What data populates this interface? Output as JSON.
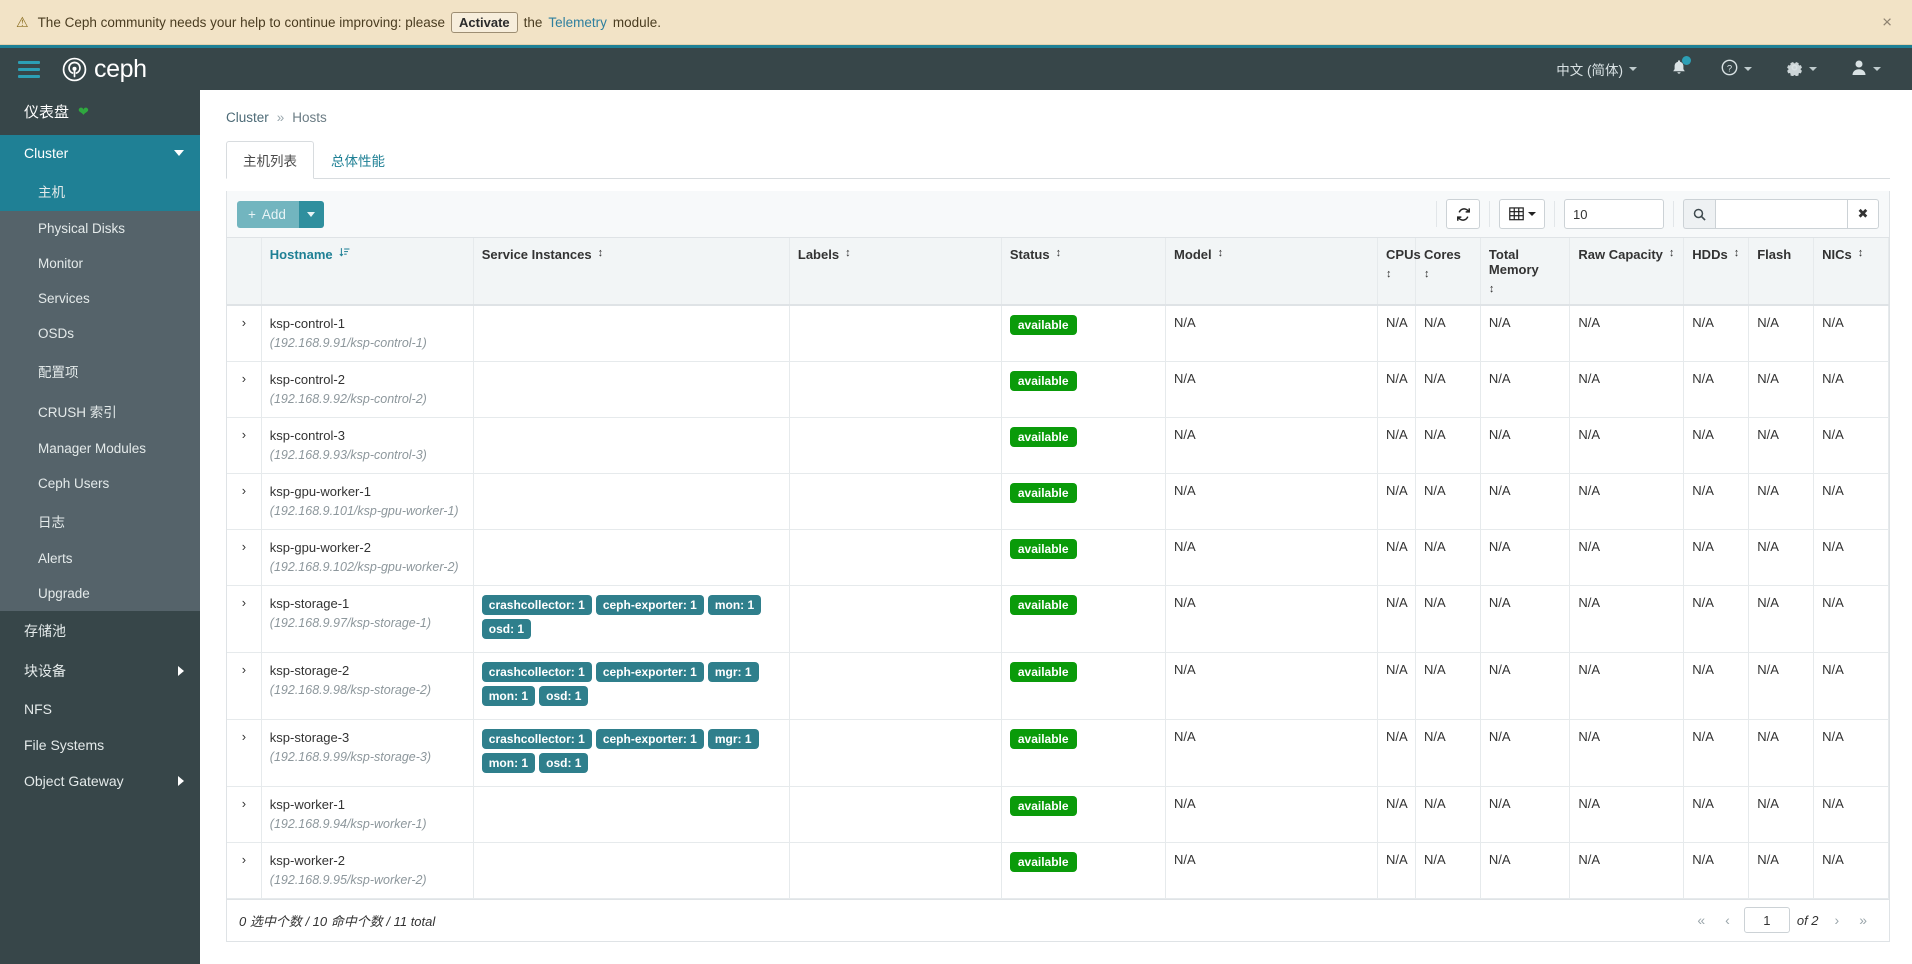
{
  "banner": {
    "icon": "warning-triangle-icon",
    "text_before": "The Ceph community needs your help to continue improving: please",
    "activate_label": "Activate",
    "text_mid": "the",
    "link_label": "Telemetry",
    "text_after": "module.",
    "close_label": "×",
    "bg_color": "#f2e3c6"
  },
  "navbar": {
    "brand": "ceph",
    "language": "中文 (简体)",
    "accent_color": "#1f8095",
    "bg_color": "#374649",
    "items": [
      {
        "name": "bell-icon",
        "label": ""
      },
      {
        "name": "help-icon",
        "label": ""
      },
      {
        "name": "gear-icon",
        "label": ""
      },
      {
        "name": "user-icon",
        "label": ""
      }
    ]
  },
  "sidebar": {
    "dashboard_label": "仪表盘",
    "cluster_label": "Cluster",
    "cluster_children": [
      {
        "label": "主机",
        "active": true
      },
      {
        "label": "Physical Disks",
        "active": false
      },
      {
        "label": "Monitor",
        "active": false
      },
      {
        "label": "Services",
        "active": false
      },
      {
        "label": "OSDs",
        "active": false
      },
      {
        "label": "配置项",
        "active": false
      },
      {
        "label": "CRUSH 索引",
        "active": false
      },
      {
        "label": "Manager Modules",
        "active": false
      },
      {
        "label": "Ceph Users",
        "active": false
      },
      {
        "label": "日志",
        "active": false
      },
      {
        "label": "Alerts",
        "active": false
      },
      {
        "label": "Upgrade",
        "active": false
      }
    ],
    "bottom_items": [
      {
        "label": "存储池",
        "expandable": false
      },
      {
        "label": "块设备",
        "expandable": true
      },
      {
        "label": "NFS",
        "expandable": false
      },
      {
        "label": "File Systems",
        "expandable": false
      },
      {
        "label": "Object Gateway",
        "expandable": true
      }
    ]
  },
  "breadcrumb": {
    "root": "Cluster",
    "separator": "»",
    "current": "Hosts"
  },
  "tabs": [
    {
      "label": "主机列表",
      "active": true
    },
    {
      "label": "总体性能",
      "active": false
    }
  ],
  "toolbar": {
    "add_label": "Add",
    "add_plus": "+",
    "refresh_icon": "refresh-icon",
    "columns_icon": "table-columns-icon",
    "page_size_value": "10",
    "search_value": "",
    "search_placeholder": "",
    "search_icon": "search-icon",
    "clear_label": "✖"
  },
  "table": {
    "columns": [
      {
        "label": "Hostname",
        "sorted": true,
        "sort_icon": "sort-amount-down-icon"
      },
      {
        "label": "Service Instances",
        "sorted": false,
        "sort_icon": "sort-icon"
      },
      {
        "label": "Labels",
        "sorted": false,
        "sort_icon": "sort-icon"
      },
      {
        "label": "Status",
        "sorted": false,
        "sort_icon": "sort-icon"
      },
      {
        "label": "Model",
        "sorted": false,
        "sort_icon": "sort-icon"
      },
      {
        "label": "CPUs",
        "sorted": false,
        "sort_icon": "sort-icon"
      },
      {
        "label": "Cores",
        "sorted": false,
        "sort_icon": "sort-icon"
      },
      {
        "label": "Total Memory",
        "sorted": false,
        "sort_icon": "sort-icon"
      },
      {
        "label": "Raw Capacity",
        "sorted": false,
        "sort_icon": "sort-icon"
      },
      {
        "label": "HDDs",
        "sorted": false,
        "sort_icon": "sort-icon"
      },
      {
        "label": "Flash",
        "sorted": false,
        "sort_icon": ""
      },
      {
        "label": "NICs",
        "sorted": false,
        "sort_icon": "sort-icon"
      }
    ],
    "expander_glyph": "›",
    "rows": [
      {
        "hostname": "ksp-control-1",
        "addr": "(192.168.9.91/ksp-control-1)",
        "services": [],
        "labels": "",
        "status": "available",
        "model": "N/A",
        "cpus": "N/A",
        "cores": "N/A",
        "memory": "N/A",
        "raw_capacity": "N/A",
        "hdds": "N/A",
        "flash": "N/A",
        "nics": "N/A"
      },
      {
        "hostname": "ksp-control-2",
        "addr": "(192.168.9.92/ksp-control-2)",
        "services": [],
        "labels": "",
        "status": "available",
        "model": "N/A",
        "cpus": "N/A",
        "cores": "N/A",
        "memory": "N/A",
        "raw_capacity": "N/A",
        "hdds": "N/A",
        "flash": "N/A",
        "nics": "N/A"
      },
      {
        "hostname": "ksp-control-3",
        "addr": "(192.168.9.93/ksp-control-3)",
        "services": [],
        "labels": "",
        "status": "available",
        "model": "N/A",
        "cpus": "N/A",
        "cores": "N/A",
        "memory": "N/A",
        "raw_capacity": "N/A",
        "hdds": "N/A",
        "flash": "N/A",
        "nics": "N/A"
      },
      {
        "hostname": "ksp-gpu-worker-1",
        "addr": "(192.168.9.101/ksp-gpu-worker-1)",
        "services": [],
        "labels": "",
        "status": "available",
        "model": "N/A",
        "cpus": "N/A",
        "cores": "N/A",
        "memory": "N/A",
        "raw_capacity": "N/A",
        "hdds": "N/A",
        "flash": "N/A",
        "nics": "N/A"
      },
      {
        "hostname": "ksp-gpu-worker-2",
        "addr": "(192.168.9.102/ksp-gpu-worker-2)",
        "services": [],
        "labels": "",
        "status": "available",
        "model": "N/A",
        "cpus": "N/A",
        "cores": "N/A",
        "memory": "N/A",
        "raw_capacity": "N/A",
        "hdds": "N/A",
        "flash": "N/A",
        "nics": "N/A"
      },
      {
        "hostname": "ksp-storage-1",
        "addr": "(192.168.9.97/ksp-storage-1)",
        "services": [
          "crashcollector: 1",
          "ceph-exporter: 1",
          "mon: 1",
          "osd: 1"
        ],
        "labels": "",
        "status": "available",
        "model": "N/A",
        "cpus": "N/A",
        "cores": "N/A",
        "memory": "N/A",
        "raw_capacity": "N/A",
        "hdds": "N/A",
        "flash": "N/A",
        "nics": "N/A"
      },
      {
        "hostname": "ksp-storage-2",
        "addr": "(192.168.9.98/ksp-storage-2)",
        "services": [
          "crashcollector: 1",
          "ceph-exporter: 1",
          "mgr: 1",
          "mon: 1",
          "osd: 1"
        ],
        "labels": "",
        "status": "available",
        "model": "N/A",
        "cpus": "N/A",
        "cores": "N/A",
        "memory": "N/A",
        "raw_capacity": "N/A",
        "hdds": "N/A",
        "flash": "N/A",
        "nics": "N/A"
      },
      {
        "hostname": "ksp-storage-3",
        "addr": "(192.168.9.99/ksp-storage-3)",
        "services": [
          "crashcollector: 1",
          "ceph-exporter: 1",
          "mgr: 1",
          "mon: 1",
          "osd: 1"
        ],
        "labels": "",
        "status": "available",
        "model": "N/A",
        "cpus": "N/A",
        "cores": "N/A",
        "memory": "N/A",
        "raw_capacity": "N/A",
        "hdds": "N/A",
        "flash": "N/A",
        "nics": "N/A"
      },
      {
        "hostname": "ksp-worker-1",
        "addr": "(192.168.9.94/ksp-worker-1)",
        "services": [],
        "labels": "",
        "status": "available",
        "model": "N/A",
        "cpus": "N/A",
        "cores": "N/A",
        "memory": "N/A",
        "raw_capacity": "N/A",
        "hdds": "N/A",
        "flash": "N/A",
        "nics": "N/A"
      },
      {
        "hostname": "ksp-worker-2",
        "addr": "(192.168.9.95/ksp-worker-2)",
        "services": [],
        "labels": "",
        "status": "available",
        "model": "N/A",
        "cpus": "N/A",
        "cores": "N/A",
        "memory": "N/A",
        "raw_capacity": "N/A",
        "hdds": "N/A",
        "flash": "N/A",
        "nics": "N/A"
      }
    ]
  },
  "footer": {
    "count_text": "0 选中个数 / 10 命中个数 / 11 total",
    "first_glyph": "«",
    "prev_glyph": "‹",
    "page_value": "1",
    "of_text": "of 2",
    "next_glyph": "›",
    "last_glyph": "»"
  },
  "colors": {
    "accent": "#1f8095",
    "nav_bg": "#374649",
    "badge_teal": "#2f7f8c",
    "badge_green": "#0a9b0a",
    "banner_bg": "#f2e3c6"
  }
}
